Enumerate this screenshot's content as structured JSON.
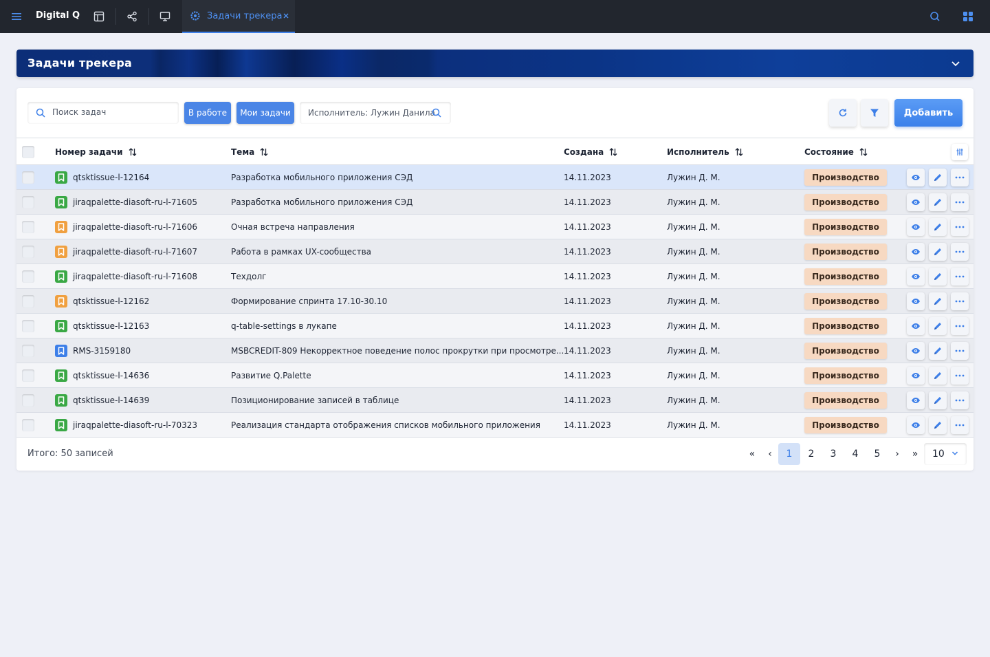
{
  "topbar": {
    "app_name": "Digital Q",
    "icons": [
      "menu-icon",
      "layout-icon",
      "share-icon",
      "monitor-icon",
      "search-icon",
      "apps-grid-icon"
    ],
    "tab": {
      "label": "Задачи трекера",
      "icon": "gear-icon"
    }
  },
  "banner": {
    "title": "Задачи трекера"
  },
  "toolbar": {
    "search_placeholder": "Поиск задач",
    "chip_work": "В работе",
    "chip_mine": "Мои задачи",
    "executor_filter": "Исполнитель: Лужин Данила",
    "add_label": "Добавить"
  },
  "table": {
    "columns": {
      "number": "Номер задачи",
      "topic": "Тема",
      "created": "Создана",
      "executor": "Исполнитель",
      "state": "Состояние"
    },
    "rows": [
      {
        "number": "qtsktissue-l-12164",
        "topic": "Разработка мобильного приложения СЭД",
        "created": "14.11.2023",
        "executor": "Лужин Д. М.",
        "state": "Производство",
        "icon_color": "#3aa845",
        "selected": true
      },
      {
        "number": "jiraqpalette-diasoft-ru-l-71605",
        "topic": "Разработка мобильного приложения СЭД",
        "created": "14.11.2023",
        "executor": "Лужин Д. М.",
        "state": "Производство",
        "icon_color": "#3aa845",
        "selected": false
      },
      {
        "number": "jiraqpalette-diasoft-ru-l-71606",
        "topic": "Очная встреча направления",
        "created": "14.11.2023",
        "executor": "Лужин Д. М.",
        "state": "Производство",
        "icon_color": "#f0a040",
        "selected": false
      },
      {
        "number": "jiraqpalette-diasoft-ru-l-71607",
        "topic": "Работа в рамках UX-сообщества",
        "created": "14.11.2023",
        "executor": "Лужин Д. М.",
        "state": "Производство",
        "icon_color": "#f0a040",
        "selected": false
      },
      {
        "number": "jiraqpalette-diasoft-ru-l-71608",
        "topic": "Техдолг",
        "created": "14.11.2023",
        "executor": "Лужин Д. М.",
        "state": "Производство",
        "icon_color": "#3aa845",
        "selected": false
      },
      {
        "number": "qtsktissue-l-12162",
        "topic": "Формирование спринта 17.10-30.10",
        "created": "14.11.2023",
        "executor": "Лужин Д. М.",
        "state": "Производство",
        "icon_color": "#f0a040",
        "selected": false
      },
      {
        "number": "qtsktissue-l-12163",
        "topic": "q-table-settings в лукапе",
        "created": "14.11.2023",
        "executor": "Лужин Д. М.",
        "state": "Производство",
        "icon_color": "#3aa845",
        "selected": false
      },
      {
        "number": "RMS-3159180",
        "topic": "MSBCREDIT-809 Некорректное поведение полос прокрутки при просмотре...",
        "created": "14.11.2023",
        "executor": "Лужин Д. М.",
        "state": "Производство",
        "icon_color": "#3d7fe8",
        "selected": false
      },
      {
        "number": "qtsktissue-l-14636",
        "topic": "Развитие Q.Palette",
        "created": "14.11.2023",
        "executor": "Лужин Д. М.",
        "state": "Производство",
        "icon_color": "#3aa845",
        "selected": false
      },
      {
        "number": "qtsktissue-l-14639",
        "topic": "Позиционирование записей в таблице",
        "created": "14.11.2023",
        "executor": "Лужин Д. М.",
        "state": "Производство",
        "icon_color": "#3aa845",
        "selected": false
      },
      {
        "number": "jiraqpalette-diasoft-ru-l-70323",
        "topic": "Реализация стандарта отображения списков мобильного приложения",
        "created": "14.11.2023",
        "executor": "Лужин Д. М.",
        "state": "Производство",
        "icon_color": "#3aa845",
        "selected": false
      }
    ]
  },
  "footer": {
    "total": "Итого: 50 записей",
    "pages": [
      "1",
      "2",
      "3",
      "4",
      "5"
    ],
    "current_page": "1",
    "first": "«",
    "prev": "‹",
    "next": "›",
    "last": "»",
    "page_size": "10"
  },
  "colors": {
    "accent": "#3d7fe8",
    "topbar": "#22262e",
    "state_badge": "#f7d9c2"
  }
}
